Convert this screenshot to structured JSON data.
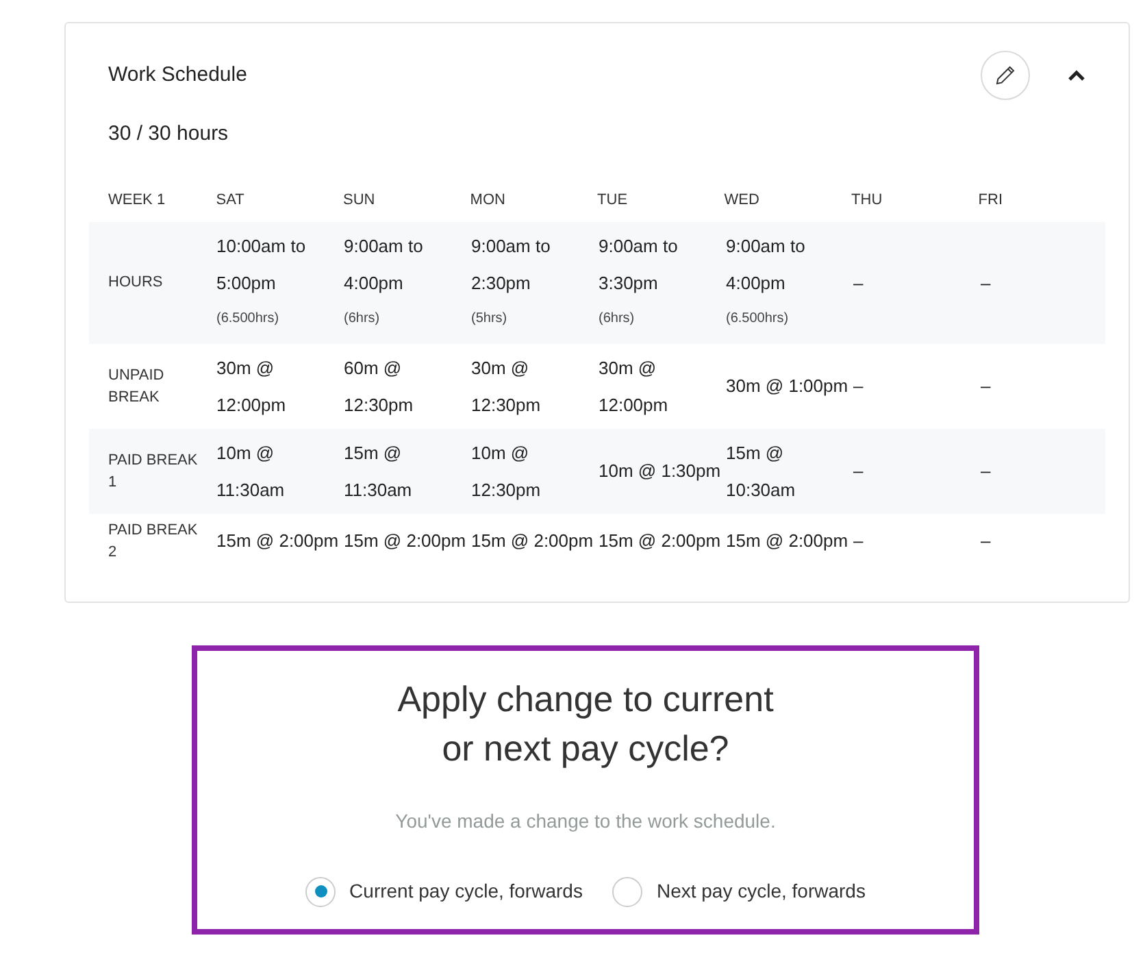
{
  "card": {
    "title": "Work Schedule",
    "total": "30 / 30 hours",
    "expanded": true
  },
  "table": {
    "columns": [
      "WEEK 1",
      "SAT",
      "SUN",
      "MON",
      "TUE",
      "WED",
      "THU",
      "FRI"
    ],
    "rows": [
      {
        "cells": [
          {
            "text": "HOURS"
          },
          {
            "text": "10:00am to 5:00pm",
            "note": "(6.500hrs)"
          },
          {
            "text": "9:00am to 4:00pm",
            "note": "(6hrs)"
          },
          {
            "text": "9:00am to 2:30pm",
            "note": "(5hrs)"
          },
          {
            "text": "9:00am to 3:30pm",
            "note": "(6hrs)"
          },
          {
            "text": "9:00am to 4:00pm",
            "note": "(6.500hrs)"
          },
          {
            "text": "–"
          },
          {
            "text": "–"
          }
        ]
      },
      {
        "cells": [
          {
            "text": "UNPAID BREAK"
          },
          {
            "text": "30m @ 12:00pm"
          },
          {
            "text": "60m @ 12:30pm"
          },
          {
            "text": "30m @ 12:30pm"
          },
          {
            "text": "30m @ 12:00pm"
          },
          {
            "text": "30m @ 1:00pm"
          },
          {
            "text": "–"
          },
          {
            "text": "–"
          }
        ]
      },
      {
        "cells": [
          {
            "text": "PAID BREAK 1"
          },
          {
            "text": "10m @ 11:30am"
          },
          {
            "text": "15m @ 11:30am"
          },
          {
            "text": "10m @ 12:30pm"
          },
          {
            "text": "10m @ 1:30pm"
          },
          {
            "text": "15m @ 10:30am"
          },
          {
            "text": "–"
          },
          {
            "text": "–"
          }
        ]
      },
      {
        "cells": [
          {
            "text": "PAID BREAK 2"
          },
          {
            "text": "15m @ 2:00pm"
          },
          {
            "text": "15m @ 2:00pm"
          },
          {
            "text": "15m @ 2:00pm"
          },
          {
            "text": "15m @ 2:00pm"
          },
          {
            "text": "15m @ 2:00pm"
          },
          {
            "text": "–"
          },
          {
            "text": "–"
          }
        ]
      }
    ]
  },
  "dialog": {
    "title": "Apply change to current or next pay cycle?",
    "message": "You've made a change to the work schedule.",
    "options": [
      {
        "label": "Current pay cycle, forwards",
        "selected": true
      },
      {
        "label": "Next pay cycle, forwards",
        "selected": false
      }
    ]
  }
}
